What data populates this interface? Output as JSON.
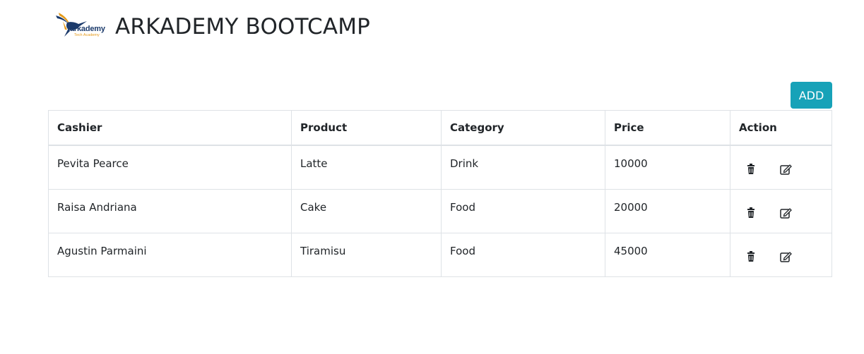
{
  "header": {
    "logo_text": "arkademy",
    "logo_subtext": "Tech Academy",
    "title": "ARKADEMY BOOTCAMP"
  },
  "toolbar": {
    "add_label": "ADD"
  },
  "colors": {
    "accent": "#17a2b8",
    "border": "#dee2e6",
    "text": "#212529"
  },
  "table": {
    "headers": {
      "cashier": "Cashier",
      "product": "Product",
      "category": "Category",
      "price": "Price",
      "action": "Action"
    },
    "rows": [
      {
        "cashier": "Pevita Pearce",
        "product": "Latte",
        "category": "Drink",
        "price": "10000",
        "actions": [
          "trash-icon",
          "edit-icon"
        ]
      },
      {
        "cashier": "Raisa Andriana",
        "product": "Cake",
        "category": "Food",
        "price": "20000",
        "actions": [
          "trash-icon",
          "edit-icon"
        ]
      },
      {
        "cashier": "Agustin Parmaini",
        "product": "Tiramisu",
        "category": "Food",
        "price": "45000",
        "actions": [
          "trash-icon",
          "edit-icon"
        ]
      }
    ]
  }
}
